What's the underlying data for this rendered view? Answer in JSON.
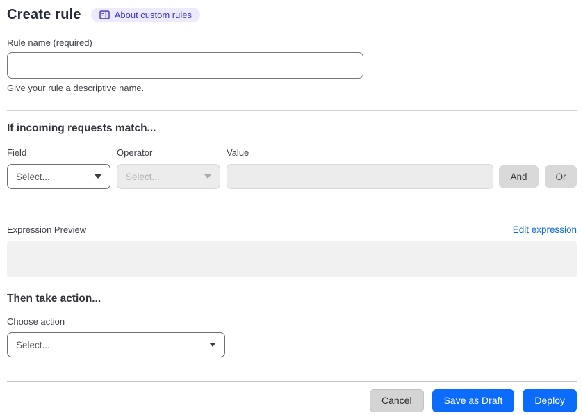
{
  "header": {
    "title": "Create rule",
    "badge": {
      "label": "About custom rules",
      "icon": "book-icon"
    }
  },
  "rule_name": {
    "label": "Rule name (required)",
    "value": "",
    "helper": "Give your rule a descriptive name."
  },
  "match_section": {
    "heading": "If incoming requests match...",
    "field": {
      "label": "Field",
      "value": "Select...",
      "disabled": false
    },
    "operator": {
      "label": "Operator",
      "value": "Select...",
      "disabled": true
    },
    "value_input": {
      "label": "Value",
      "value": ""
    },
    "and_button": "And",
    "or_button": "Or",
    "expression_preview_label": "Expression Preview",
    "edit_expression_link": "Edit expression",
    "expression_value": ""
  },
  "action_section": {
    "heading": "Then take action...",
    "choose_action_label": "Choose action",
    "action_select_value": "Select..."
  },
  "footer": {
    "cancel": "Cancel",
    "save_as_draft": "Save as Draft",
    "deploy": "Deploy"
  },
  "colors": {
    "accent_blue": "#0b6bfb",
    "link_blue": "#0b6bdb",
    "badge_bg": "#eceafc",
    "badge_text": "#3d35c4"
  }
}
